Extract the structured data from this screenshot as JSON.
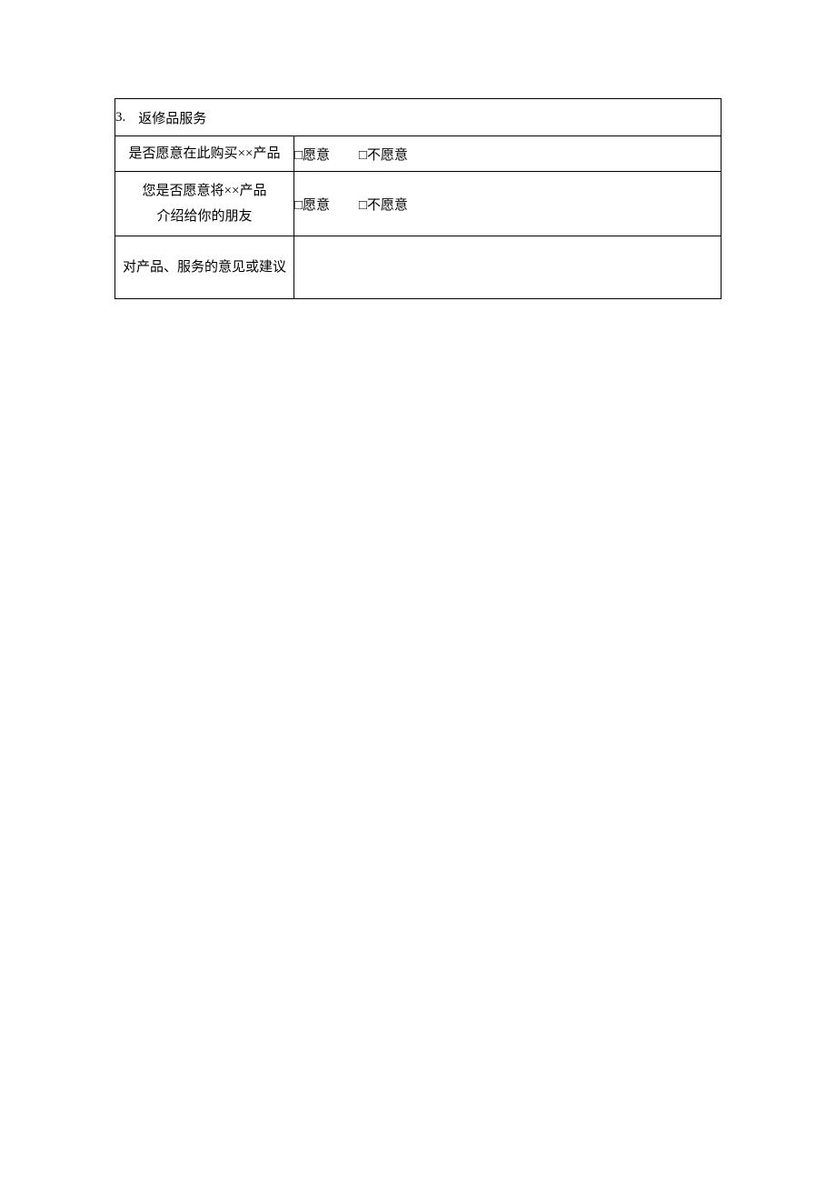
{
  "section": {
    "number": "3.",
    "title": "返修品服务"
  },
  "rows": [
    {
      "label": "是否愿意在此购买××产品",
      "options": [
        "□愿意",
        "□不愿意"
      ]
    },
    {
      "label_lines": [
        "您是否愿意将××产品",
        "介绍给你的朋友"
      ],
      "options": [
        "□愿意",
        "□不愿意"
      ]
    },
    {
      "label": "对产品、服务的意见或建议",
      "options": []
    }
  ]
}
